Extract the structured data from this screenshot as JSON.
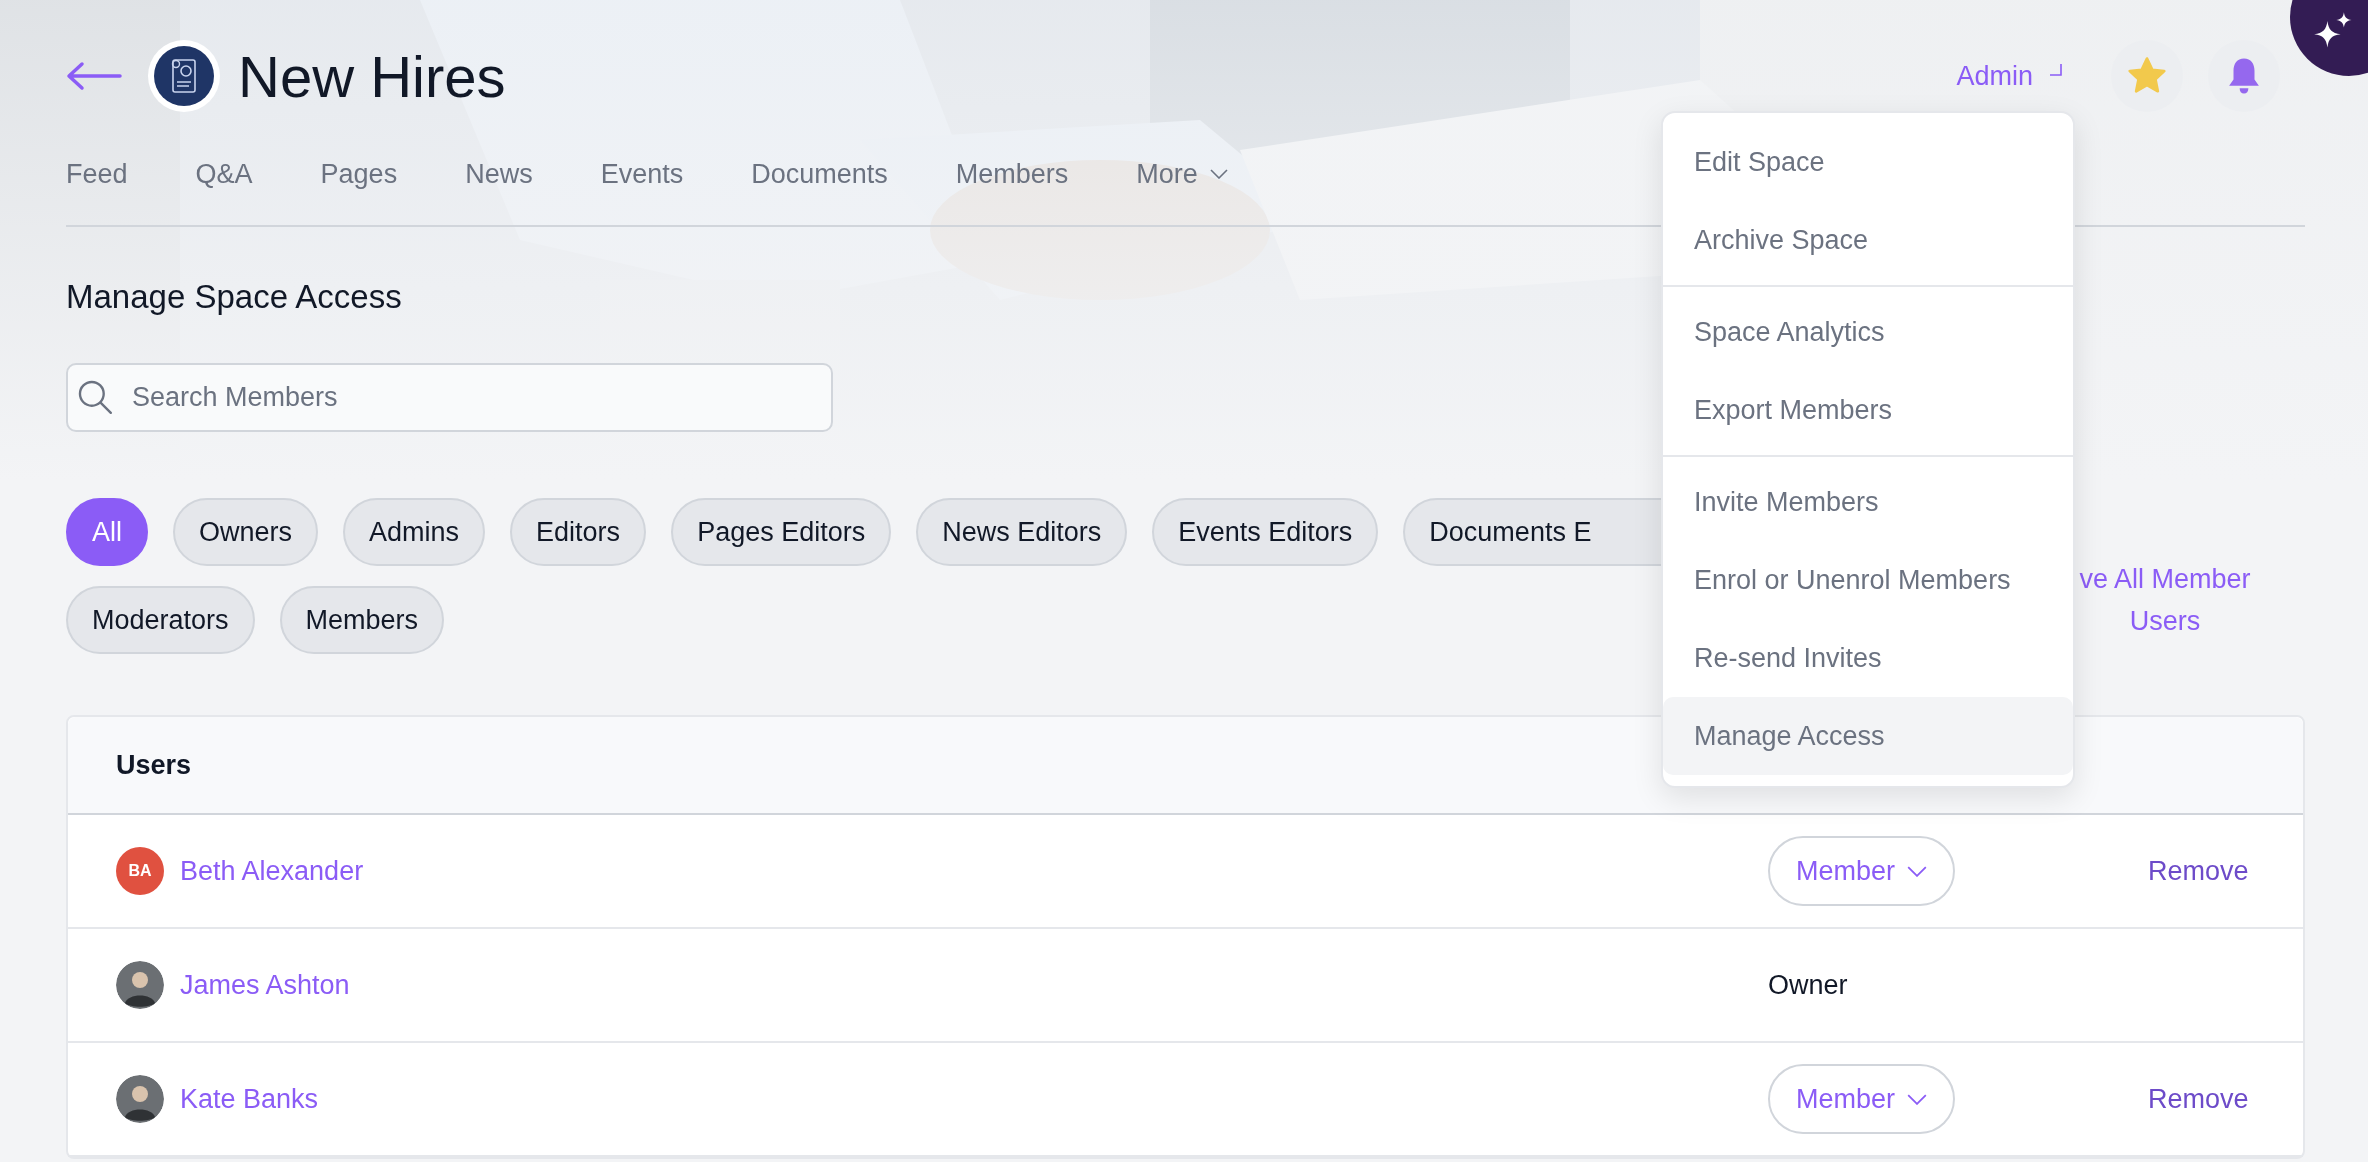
{
  "header": {
    "title": "New Hires",
    "role": "Admin"
  },
  "tabs": [
    {
      "label": "Feed",
      "kind": "link"
    },
    {
      "label": "Q&A",
      "kind": "link"
    },
    {
      "label": "Pages",
      "kind": "link"
    },
    {
      "label": "News",
      "kind": "link"
    },
    {
      "label": "Events",
      "kind": "link"
    },
    {
      "label": "Documents",
      "kind": "link"
    },
    {
      "label": "Members",
      "kind": "link"
    },
    {
      "label": "More",
      "kind": "dropdown"
    }
  ],
  "section_title": "Manage Space Access",
  "search": {
    "placeholder": "Search Members"
  },
  "filters": [
    {
      "label": "All",
      "selected": true
    },
    {
      "label": "Owners",
      "selected": false
    },
    {
      "label": "Admins",
      "selected": false
    },
    {
      "label": "Editors",
      "selected": false
    },
    {
      "label": "Pages Editors",
      "selected": false
    },
    {
      "label": "News Editors",
      "selected": false
    },
    {
      "label": "Events Editors",
      "selected": false
    },
    {
      "label": "Documents E",
      "selected": false
    },
    {
      "label": "Moderators",
      "selected": false
    },
    {
      "label": "Members",
      "selected": false
    }
  ],
  "bulk_link": "ve All Member Users",
  "table": {
    "columns": [
      "Users"
    ],
    "rows": [
      {
        "name": "Beth Alexander",
        "avatar": {
          "kind": "initials",
          "initials": "BA"
        },
        "role": {
          "kind": "dropdown",
          "label": "Member"
        },
        "action": "Remove"
      },
      {
        "name": "James Ashton",
        "role": {
          "kind": "text",
          "label": "Owner"
        }
      },
      {
        "name": "Kate Banks",
        "role": {
          "kind": "dropdown",
          "label": "Member"
        },
        "action": "Remove"
      }
    ]
  },
  "menu": {
    "sections": [
      {
        "items": [
          {
            "label": "Edit Space",
            "selected": false
          },
          {
            "label": "Archive Space",
            "selected": false
          }
        ]
      },
      {
        "items": [
          {
            "label": "Space Analytics",
            "selected": false
          },
          {
            "label": "Export Members",
            "selected": false
          }
        ]
      },
      {
        "items": [
          {
            "label": "Invite Members",
            "selected": false
          },
          {
            "label": "Enrol or Unenrol Members",
            "selected": false
          },
          {
            "label": "Re-send Invites",
            "selected": false
          },
          {
            "label": "Manage Access",
            "selected": true
          }
        ]
      }
    ]
  }
}
